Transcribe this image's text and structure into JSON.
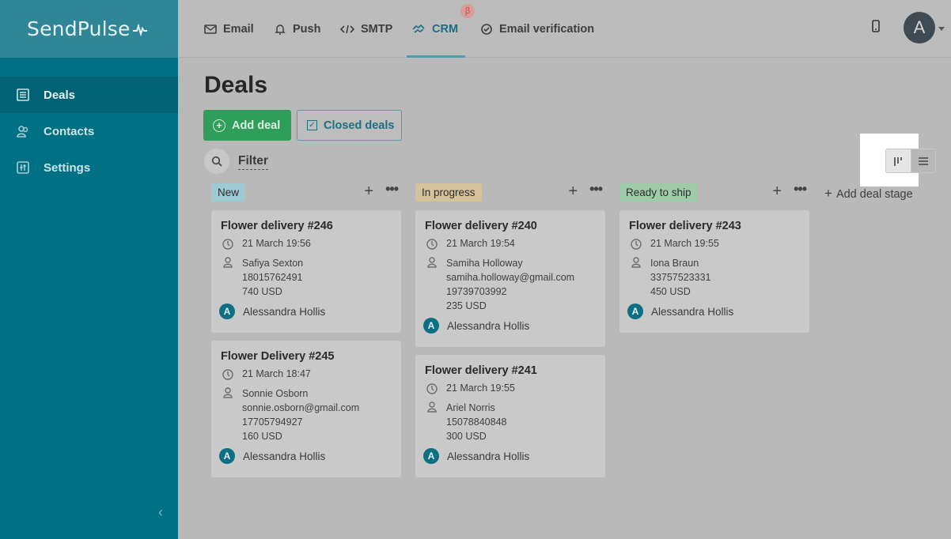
{
  "app": {
    "logo": "SendPulse"
  },
  "topnav": [
    {
      "label": "Email",
      "icon": "mail-icon"
    },
    {
      "label": "Push",
      "icon": "bell-icon"
    },
    {
      "label": "SMTP",
      "icon": "code-icon"
    },
    {
      "label": "CRM",
      "icon": "crm-icon",
      "active": true,
      "badge": "β"
    },
    {
      "label": "Email verification",
      "icon": "check-circle-icon"
    }
  ],
  "user": {
    "initial": "A"
  },
  "sidebar": {
    "items": [
      {
        "label": "Deals",
        "icon": "list-icon",
        "active": true
      },
      {
        "label": "Contacts",
        "icon": "contacts-icon"
      },
      {
        "label": "Settings",
        "icon": "settings-icon"
      }
    ],
    "collapse": "‹"
  },
  "page": {
    "title": "Deals",
    "add_deal": "Add deal",
    "closed_deals": "Closed deals",
    "filter": "Filter",
    "add_stage": "Add deal stage"
  },
  "colors": {
    "accent": "#007185",
    "green": "#2e9e5a"
  },
  "board": {
    "columns": [
      {
        "stage": "New",
        "color": "#9ccbd4",
        "cards": [
          {
            "title": "Flower delivery #246",
            "date": "21 March 19:56",
            "contact": [
              "Safiya Sexton",
              "18015762491",
              "740 USD"
            ],
            "owner": "Alessandra Hollis"
          },
          {
            "title": "Flower Delivery #245",
            "date": "21 March 18:47",
            "contact": [
              "Sonnie Osborn",
              "sonnie.osborn@gmail.com",
              "17705794927",
              "160 USD"
            ],
            "owner": "Alessandra Hollis"
          }
        ]
      },
      {
        "stage": "In progress",
        "color": "#d6c29a",
        "cards": [
          {
            "title": "Flower delivery #240",
            "date": "21 March 19:54",
            "contact": [
              "Samiha Holloway",
              "samiha.holloway@gmail.com",
              "19739703992",
              "235 USD"
            ],
            "owner": "Alessandra Hollis"
          },
          {
            "title": "Flower delivery #241",
            "date": "21 March 19:55",
            "contact": [
              "Ariel Norris",
              "15078840848",
              "300 USD"
            ],
            "owner": "Alessandra Hollis"
          }
        ]
      },
      {
        "stage": "Ready to ship",
        "color": "#9fcca8",
        "cards": [
          {
            "title": "Flower delivery #243",
            "date": "21 March 19:55",
            "contact": [
              "Iona Braun",
              "33757523331",
              "450 USD"
            ],
            "owner": "Alessandra Hollis"
          }
        ]
      }
    ]
  }
}
